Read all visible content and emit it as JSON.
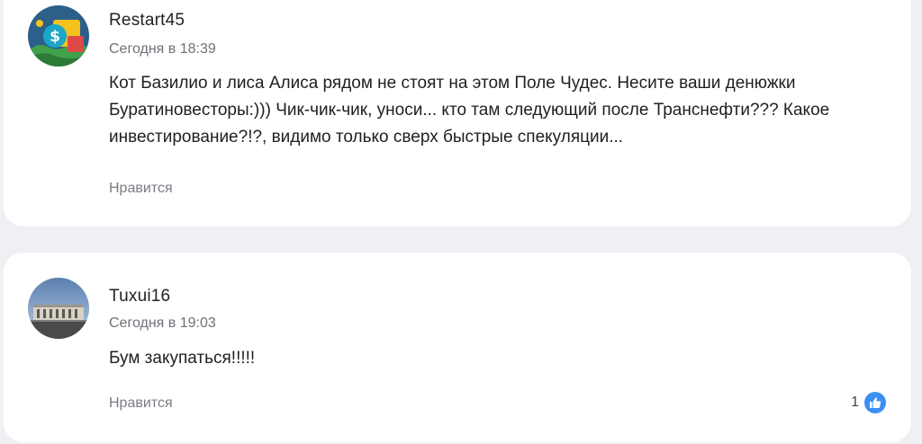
{
  "comments": [
    {
      "author": "Restart45",
      "time": "Сегодня в 18:39",
      "text": "Кот Базилио и лиса Алиса рядом не стоят на этом Поле Чудес. Несите ваши денюжки Буратиновесторы:))) Чик-чик-чик, уноси... кто там следующий после Транснефти??? Какое инвестирование?!?, видимо только сверх быстрые спекуляции...",
      "like_label": "Нравится",
      "avatar_icon": "money-avatar-icon"
    },
    {
      "author": "Tuxui16",
      "time": "Сегодня в 19:03",
      "text": "Бум закупаться!!!!!",
      "like_label": "Нравится",
      "like_count": "1",
      "reaction_icon": "thumbs-up-icon",
      "avatar_icon": "building-avatar-icon"
    }
  ],
  "colors": {
    "background": "#eef0f3",
    "card": "#ffffff",
    "reaction_blue": "#3d8ef2",
    "muted_text": "#6f7178"
  }
}
